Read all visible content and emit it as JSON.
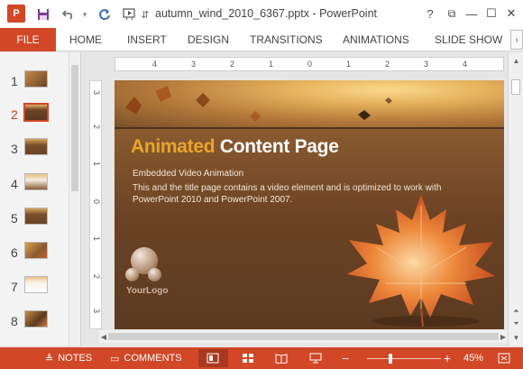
{
  "title_bar": {
    "app_initial": "P",
    "document_title": "autumn_wind_2010_6367.pptx - PowerPoint",
    "help": "?",
    "restore_ribbon": "⧉",
    "minimize": "—",
    "maximize": "☐",
    "close": "✕"
  },
  "ribbon": {
    "file": "FILE",
    "tabs": [
      "HOME",
      "INSERT",
      "DESIGN",
      "TRANSITIONS",
      "ANIMATIONS",
      "SLIDE SHOW"
    ],
    "more": "›"
  },
  "thumbnails": {
    "numbers": [
      "1",
      "2",
      "3",
      "4",
      "5",
      "6",
      "7",
      "8"
    ],
    "active_index": 1
  },
  "ruler": {
    "horizontal_ticks": [
      "4",
      "3",
      "2",
      "1",
      "0",
      "1",
      "2",
      "3",
      "4"
    ],
    "vertical_ticks": [
      "3",
      "2",
      "1",
      "0",
      "1",
      "2",
      "3"
    ]
  },
  "slide": {
    "title_accent": "Animated",
    "title_main": "Content Page",
    "subtitle": "Embedded Video Animation",
    "body": "This and the title page contains a video element and is optimized to work with PowerPoint 2010 and PowerPoint 2007.",
    "logo_text": "YourLogo"
  },
  "status_bar": {
    "notes": "NOTES",
    "comments": "COMMENTS",
    "zoom_minus": "−",
    "zoom_plus": "+",
    "zoom_level": "45%"
  },
  "colors": {
    "accent": "#d24726",
    "title_accent": "#e8a62a"
  }
}
